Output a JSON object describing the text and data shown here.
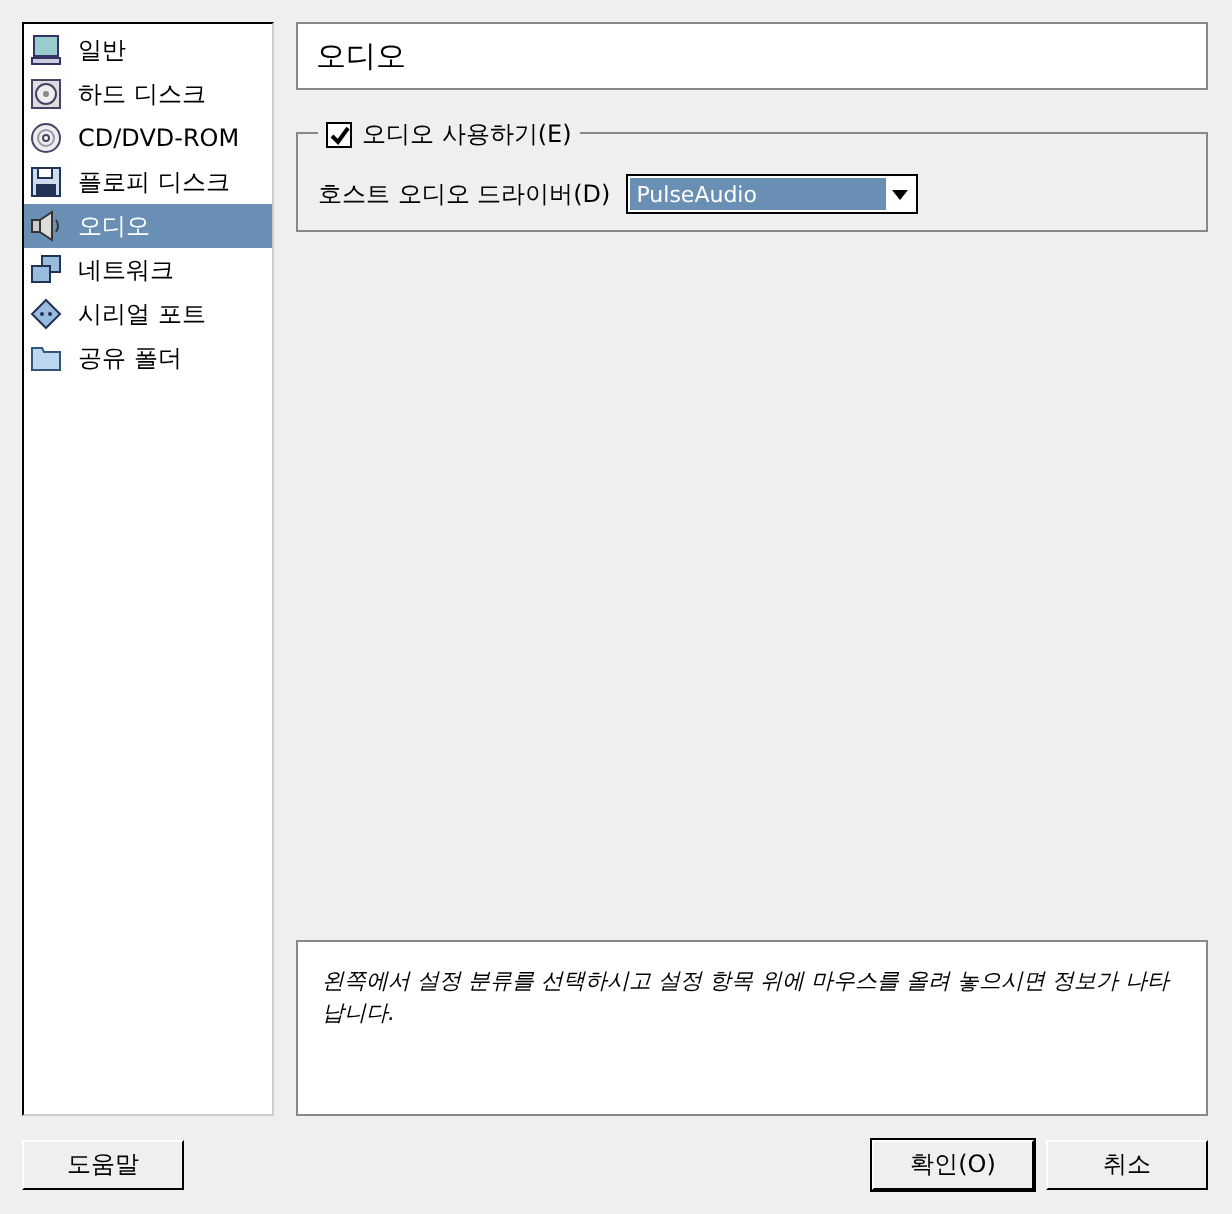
{
  "sidebar": {
    "items": [
      {
        "label": "일반",
        "kind": "monitor",
        "selected": false
      },
      {
        "label": "하드 디스크",
        "kind": "disk",
        "selected": false
      },
      {
        "label": "CD/DVD-ROM",
        "kind": "cd",
        "selected": false
      },
      {
        "label": "플로피 디스크",
        "kind": "floppy",
        "selected": false
      },
      {
        "label": "오디오",
        "kind": "audio",
        "selected": true
      },
      {
        "label": "네트워크",
        "kind": "network",
        "selected": false
      },
      {
        "label": "시리얼 포트",
        "kind": "serial",
        "selected": false
      },
      {
        "label": "공유 폴더",
        "kind": "folder",
        "selected": false
      }
    ]
  },
  "page_title": "오디오",
  "audio_group": {
    "enable_label": "오디오 사용하기(E)",
    "checked": true,
    "driver_label": "호스트 오디오 드라이버(D)",
    "driver_value": "PulseAudio"
  },
  "info_text": "왼쪽에서 설정 분류를 선택하시고 설정 항목 위에 마우스를 올려 놓으시면 정보가 나타납니다.",
  "buttons": {
    "help": "도움말",
    "ok": "확인(O)",
    "cancel": "취소"
  }
}
